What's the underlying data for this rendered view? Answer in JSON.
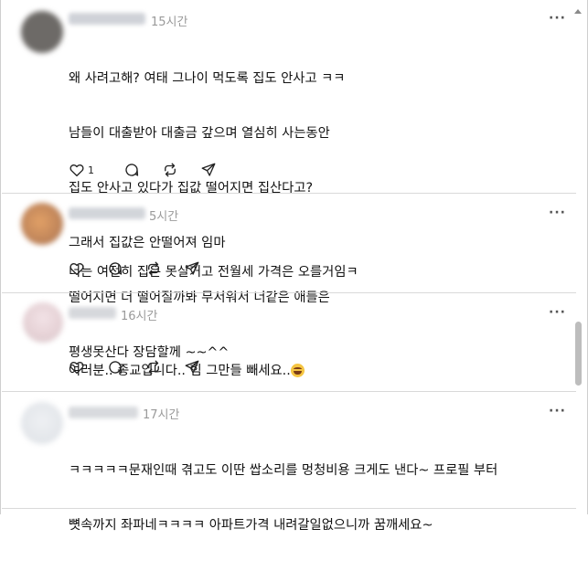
{
  "posts": [
    {
      "time": "15시간",
      "lines": [
        "왜 사려고해? 여태 그나이 먹도록 집도 안사고 ㅋㅋ",
        "남들이 대출받아 대출금 갚으며 열심히 사는동안",
        "집도 안사고 있다가 집값 떨어지면 집산다고?",
        "그래서 집값은 안떨어져 임마",
        "떨어지면 더 떨어질까봐 무서워서 너같은 애들은",
        "평생못산다 장담할께 ~~^^"
      ],
      "like_count": "1"
    },
    {
      "time": "5시간",
      "lines": [
        "너는 여전히 집은 못살거고 전월세 가격은 오를거임ㅋ"
      ]
    },
    {
      "time": "16시간",
      "text": "여러분.. 종교입니다.. 힘 그만들 빼세요..",
      "emoji": "grinning-face-emoji"
    },
    {
      "time": "17시간",
      "lines": [
        "ㅋㅋㅋㅋㅋ문재인때 겪고도 이딴 쌉소리를 멍청비용 크게도 낸다~ 프로필 부터",
        "뼛속까지 좌파네ㅋㅋㅋㅋ 아파트가격 내려갈일없으니까 꿈깨세요~"
      ]
    }
  ],
  "more_label": "···",
  "icons": {
    "like": "heart-icon",
    "reply": "comment-icon",
    "repost": "repost-icon",
    "share": "send-icon",
    "more": "more-icon"
  },
  "colors": {
    "text": "#111111",
    "meta": "#9a9a9a",
    "separator": "#d9d9d9"
  }
}
